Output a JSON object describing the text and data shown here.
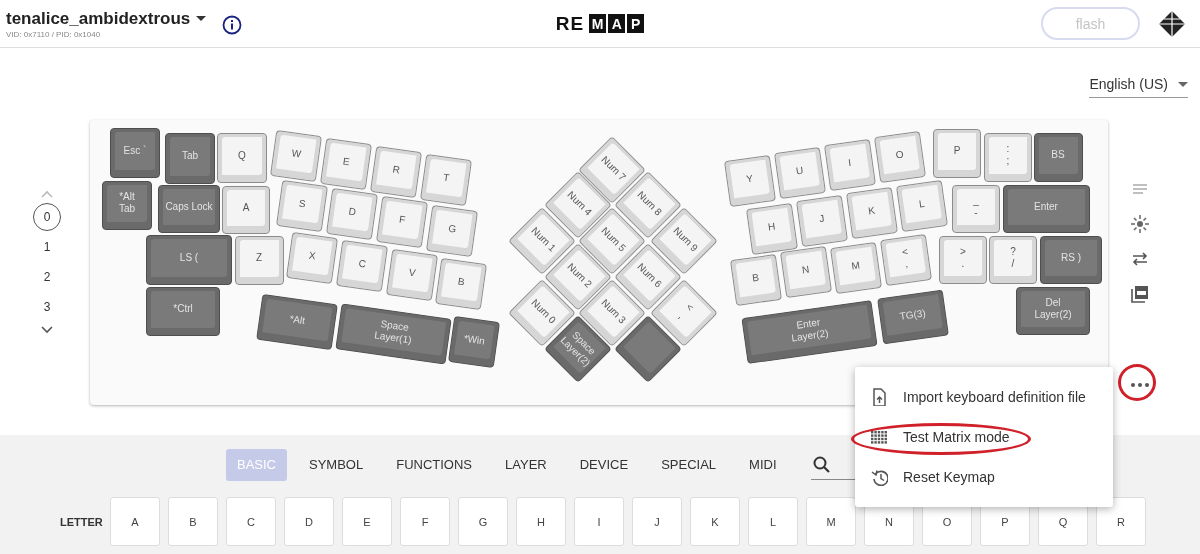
{
  "header": {
    "title": "tenalice_ambidextrous",
    "subtitle": "VID: 0x7110 / PID: 0x1040",
    "logo": {
      "plain": "RE",
      "boxed": [
        "M",
        "A",
        "P"
      ]
    },
    "flash_button": {
      "label": "flash",
      "disabled": true
    }
  },
  "language": {
    "value": "English (US)"
  },
  "layers": [
    {
      "label": "0",
      "selected": true
    },
    {
      "label": "1",
      "selected": false
    },
    {
      "label": "2",
      "selected": false
    },
    {
      "label": "3",
      "selected": false
    }
  ],
  "keyboard": {
    "keys": [
      {
        "labels": [
          "Esc `"
        ],
        "kind": "mod"
      },
      {
        "labels": [
          "Tab"
        ],
        "kind": "mod"
      },
      {
        "labels": [
          "Q"
        ],
        "kind": "letter"
      },
      {
        "labels": [
          "W"
        ],
        "kind": "letter"
      },
      {
        "labels": [
          "E"
        ],
        "kind": "letter"
      },
      {
        "labels": [
          "R"
        ],
        "kind": "letter"
      },
      {
        "labels": [
          "T"
        ],
        "kind": "letter"
      },
      {
        "labels": [
          "*Alt",
          "Tab"
        ],
        "kind": "mod"
      },
      {
        "labels": [
          "Caps Lock"
        ],
        "kind": "mod"
      },
      {
        "labels": [
          "A"
        ],
        "kind": "letter"
      },
      {
        "labels": [
          "S"
        ],
        "kind": "letter"
      },
      {
        "labels": [
          "D"
        ],
        "kind": "letter"
      },
      {
        "labels": [
          "F"
        ],
        "kind": "letter"
      },
      {
        "labels": [
          "G"
        ],
        "kind": "letter"
      },
      {
        "labels": [
          "LS ("
        ],
        "kind": "mod"
      },
      {
        "labels": [
          "Z"
        ],
        "kind": "letter"
      },
      {
        "labels": [
          "X"
        ],
        "kind": "letter"
      },
      {
        "labels": [
          "C"
        ],
        "kind": "letter"
      },
      {
        "labels": [
          "V"
        ],
        "kind": "letter"
      },
      {
        "labels": [
          "B"
        ],
        "kind": "letter"
      },
      {
        "labels": [
          "*Ctrl"
        ],
        "kind": "mod"
      },
      {
        "labels": [
          "*Alt"
        ],
        "kind": "mod"
      },
      {
        "labels": [
          "Space",
          "Layer(1)"
        ],
        "kind": "mod"
      },
      {
        "labels": [
          "*Win"
        ],
        "kind": "mod"
      },
      {
        "labels": [
          "Num 7"
        ],
        "kind": "letter"
      },
      {
        "labels": [
          "Num 4"
        ],
        "kind": "letter"
      },
      {
        "labels": [
          "Num 8"
        ],
        "kind": "letter"
      },
      {
        "labels": [
          "Num 1"
        ],
        "kind": "letter"
      },
      {
        "labels": [
          "Num 5"
        ],
        "kind": "letter"
      },
      {
        "labels": [
          "Num 9"
        ],
        "kind": "letter"
      },
      {
        "labels": [
          "Num 2"
        ],
        "kind": "letter"
      },
      {
        "labels": [
          "Num 6"
        ],
        "kind": "letter"
      },
      {
        "labels": [
          "Num 0"
        ],
        "kind": "letter"
      },
      {
        "labels": [
          "Num 3"
        ],
        "kind": "letter"
      },
      {
        "labels": [
          "<",
          ","
        ],
        "kind": "letter"
      },
      {
        "labels": [
          "Space",
          "Layer(2)"
        ],
        "kind": "mod"
      },
      {
        "kind": "mod"
      },
      {
        "labels": [
          "Y"
        ],
        "kind": "letter"
      },
      {
        "labels": [
          "U"
        ],
        "kind": "letter"
      },
      {
        "labels": [
          "I"
        ],
        "kind": "letter"
      },
      {
        "labels": [
          "O"
        ],
        "kind": "letter"
      },
      {
        "labels": [
          "P"
        ],
        "kind": "letter"
      },
      {
        "labels": [
          ":",
          ";"
        ],
        "kind": "letter"
      },
      {
        "labels": [
          "BS"
        ],
        "kind": "mod"
      },
      {
        "labels": [
          "H"
        ],
        "kind": "letter"
      },
      {
        "labels": [
          "J"
        ],
        "kind": "letter"
      },
      {
        "labels": [
          "K"
        ],
        "kind": "letter"
      },
      {
        "labels": [
          "L"
        ],
        "kind": "letter"
      },
      {
        "labels": [
          "_",
          "-"
        ],
        "kind": "letter"
      },
      {
        "labels": [
          "Enter"
        ],
        "kind": "mod"
      },
      {
        "labels": [
          "B"
        ],
        "kind": "letter"
      },
      {
        "labels": [
          "N"
        ],
        "kind": "letter"
      },
      {
        "labels": [
          "M"
        ],
        "kind": "letter"
      },
      {
        "labels": [
          "<",
          ","
        ],
        "kind": "letter"
      },
      {
        "labels": [
          ">",
          "."
        ],
        "kind": "letter"
      },
      {
        "labels": [
          "?",
          "/"
        ],
        "kind": "letter"
      },
      {
        "labels": [
          "RS )"
        ],
        "kind": "mod"
      },
      {
        "labels": [
          "Enter",
          "Layer(2)"
        ],
        "kind": "mod"
      },
      {
        "labels": [
          "TG(3)"
        ],
        "kind": "mod"
      },
      {
        "labels": [
          "Del",
          "Layer(2)"
        ],
        "kind": "mod"
      }
    ]
  },
  "more_button": {
    "circled": true
  },
  "menu": {
    "items": [
      {
        "label": "Import keyboard definition file",
        "circled": false
      },
      {
        "label": "Test Matrix mode",
        "circled": true
      },
      {
        "label": "Reset Keymap",
        "circled": false
      }
    ]
  },
  "palette": {
    "tabs": [
      {
        "label": "BASIC",
        "selected": true
      },
      {
        "label": "SYMBOL",
        "selected": false
      },
      {
        "label": "FUNCTIONS",
        "selected": false
      },
      {
        "label": "LAYER",
        "selected": false
      },
      {
        "label": "DEVICE",
        "selected": false
      },
      {
        "label": "SPECIAL",
        "selected": false
      },
      {
        "label": "MIDI",
        "selected": false
      }
    ],
    "row_label": "LETTER",
    "keys": [
      "A",
      "B",
      "C",
      "D",
      "E",
      "F",
      "G",
      "H",
      "I",
      "J",
      "K",
      "L",
      "M",
      "N",
      "O",
      "P",
      "Q",
      "R"
    ]
  }
}
